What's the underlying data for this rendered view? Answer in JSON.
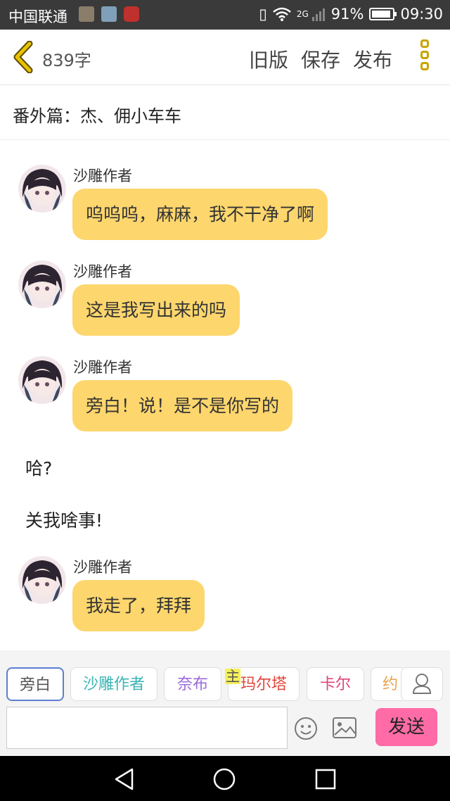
{
  "status_bar": {
    "carrier": "中国联通",
    "network": "2G",
    "battery": "91%",
    "battery_level": 0.91,
    "time": "09:30"
  },
  "header": {
    "word_count": "839字",
    "old_version": "旧版",
    "save": "保存",
    "publish": "发布"
  },
  "chapter_title": "番外篇：杰、佣小车车",
  "messages": [
    {
      "speaker": "沙雕作者",
      "text": "呜呜呜，麻麻，我不干净了啊"
    },
    {
      "speaker": "沙雕作者",
      "text": "这是我写出来的吗"
    },
    {
      "speaker": "沙雕作者",
      "text": "旁白！说！是不是你写的"
    },
    {
      "narration": "哈?"
    },
    {
      "narration": "关我啥事!"
    },
    {
      "speaker": "沙雕作者",
      "text": "我走了，拜拜"
    }
  ],
  "characters": [
    {
      "name": "旁白",
      "color": "#555555"
    },
    {
      "name": "沙雕作者",
      "color": "#3bb4b4"
    },
    {
      "name": "奈布",
      "color": "#9b6ad8"
    },
    {
      "name": "玛尔塔",
      "color": "#e0453a",
      "badge": "主"
    },
    {
      "name": "卡尔",
      "color": "#e0457a"
    },
    {
      "name": "约",
      "color": "#e8a04a"
    }
  ],
  "input": {
    "value": ""
  },
  "send_label": "发送",
  "colors": {
    "bubble": "#fdd66d",
    "send": "#ff6ba6",
    "accent": "#c9a400"
  }
}
